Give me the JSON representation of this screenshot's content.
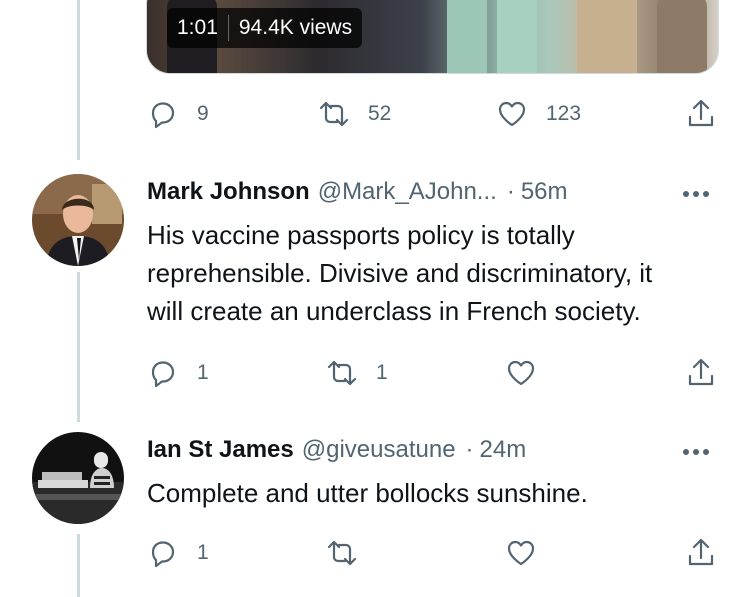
{
  "video": {
    "duration": "1:01",
    "views": "94.4K views"
  },
  "top_actions": {
    "replies": "9",
    "retweets": "52",
    "likes": "123"
  },
  "tweets": [
    {
      "name": "Mark Johnson",
      "handle": "@Mark_AJohn...",
      "separator": "·",
      "time": "56m",
      "text_lines": [
        "His vaccine passports policy is totally",
        "reprehensible. Divisive and discriminatory, it",
        "will create an underclass in French society."
      ],
      "replies": "1",
      "retweets": "1",
      "likes": ""
    },
    {
      "name": "Ian St James",
      "handle": "@giveusatune",
      "separator": "·",
      "time": "24m",
      "text_lines": [
        "Complete and utter bollocks sunshine."
      ],
      "replies": "1",
      "retweets": "",
      "likes": ""
    }
  ],
  "icons": [
    "reply-icon",
    "retweet-icon",
    "like-icon",
    "share-icon",
    "more-icon"
  ],
  "colors": {
    "text": "#0f1419",
    "secondary": "#536471",
    "thread_line": "#cfd9de"
  }
}
